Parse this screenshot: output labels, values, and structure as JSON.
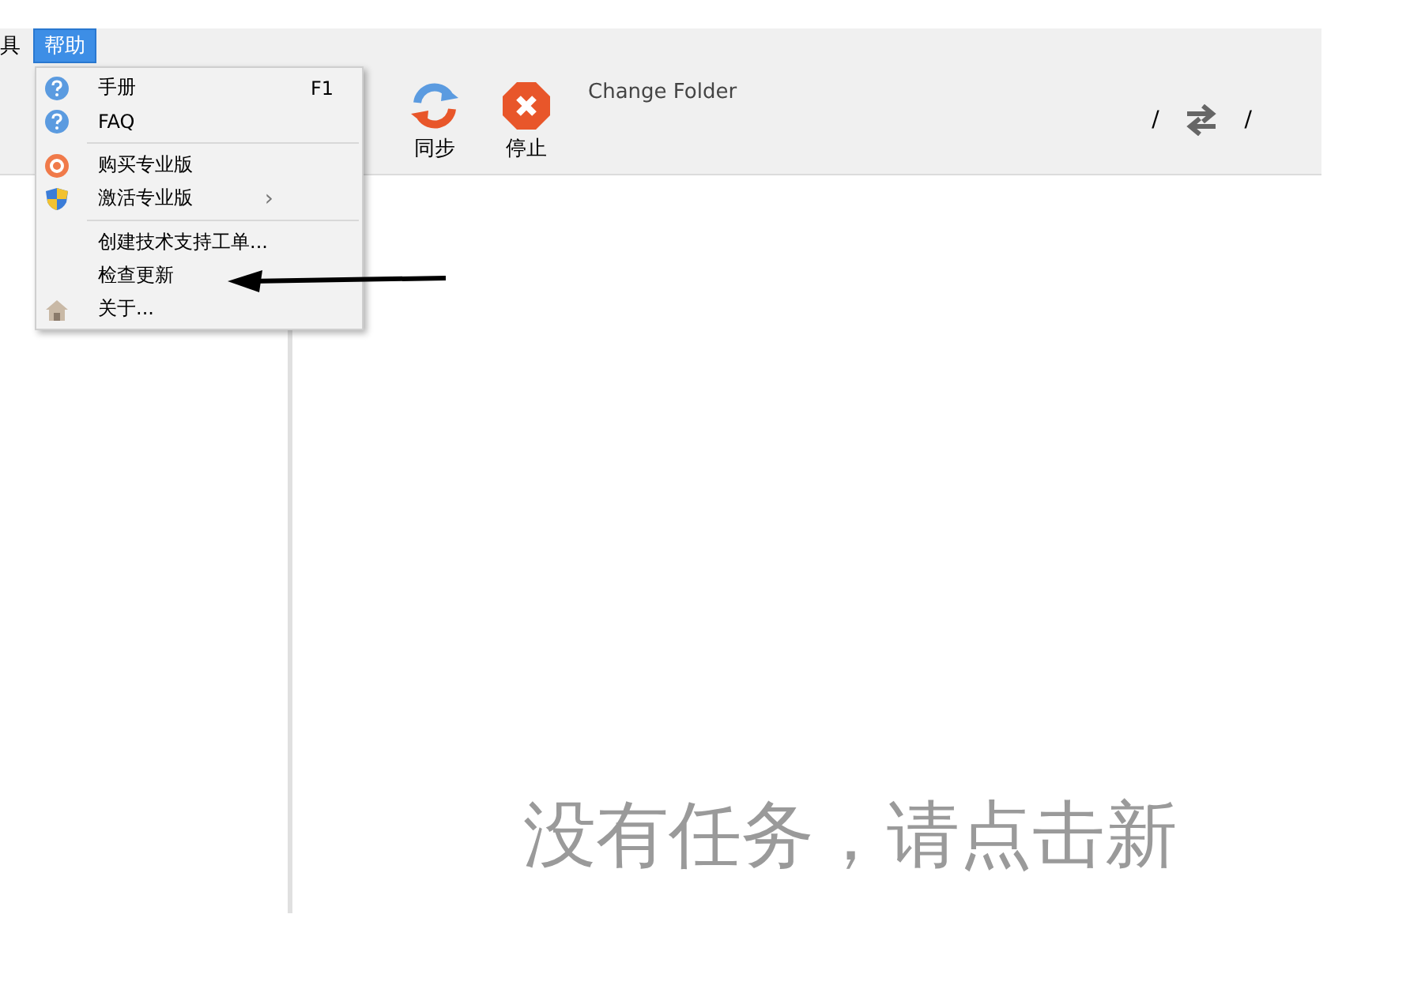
{
  "menubar": [
    {
      "label": "具",
      "selected": false
    },
    {
      "label": "帮助",
      "selected": true
    }
  ],
  "help_menu": [
    {
      "kind": "item",
      "label": "手册",
      "shortcut": "F1"
    },
    {
      "kind": "item",
      "label": "FAQ"
    },
    {
      "kind": "separator"
    },
    {
      "kind": "item",
      "label": "购买专业版"
    },
    {
      "kind": "submenu",
      "label": "激活专业版",
      "arrow": "›"
    },
    {
      "kind": "separator"
    },
    {
      "kind": "item",
      "label": "创建技术支持工单..."
    },
    {
      "kind": "item",
      "label": "检查更新"
    },
    {
      "kind": "item",
      "label": "关于..."
    }
  ],
  "toolbar": {
    "buttons": [
      {
        "kind": "sync",
        "label": "同步"
      },
      {
        "kind": "stop",
        "label": "停止"
      }
    ],
    "change_folder": "Change Folder",
    "path_left": "/",
    "path_right": "/"
  },
  "empty_message": "没有任务，请点击新"
}
